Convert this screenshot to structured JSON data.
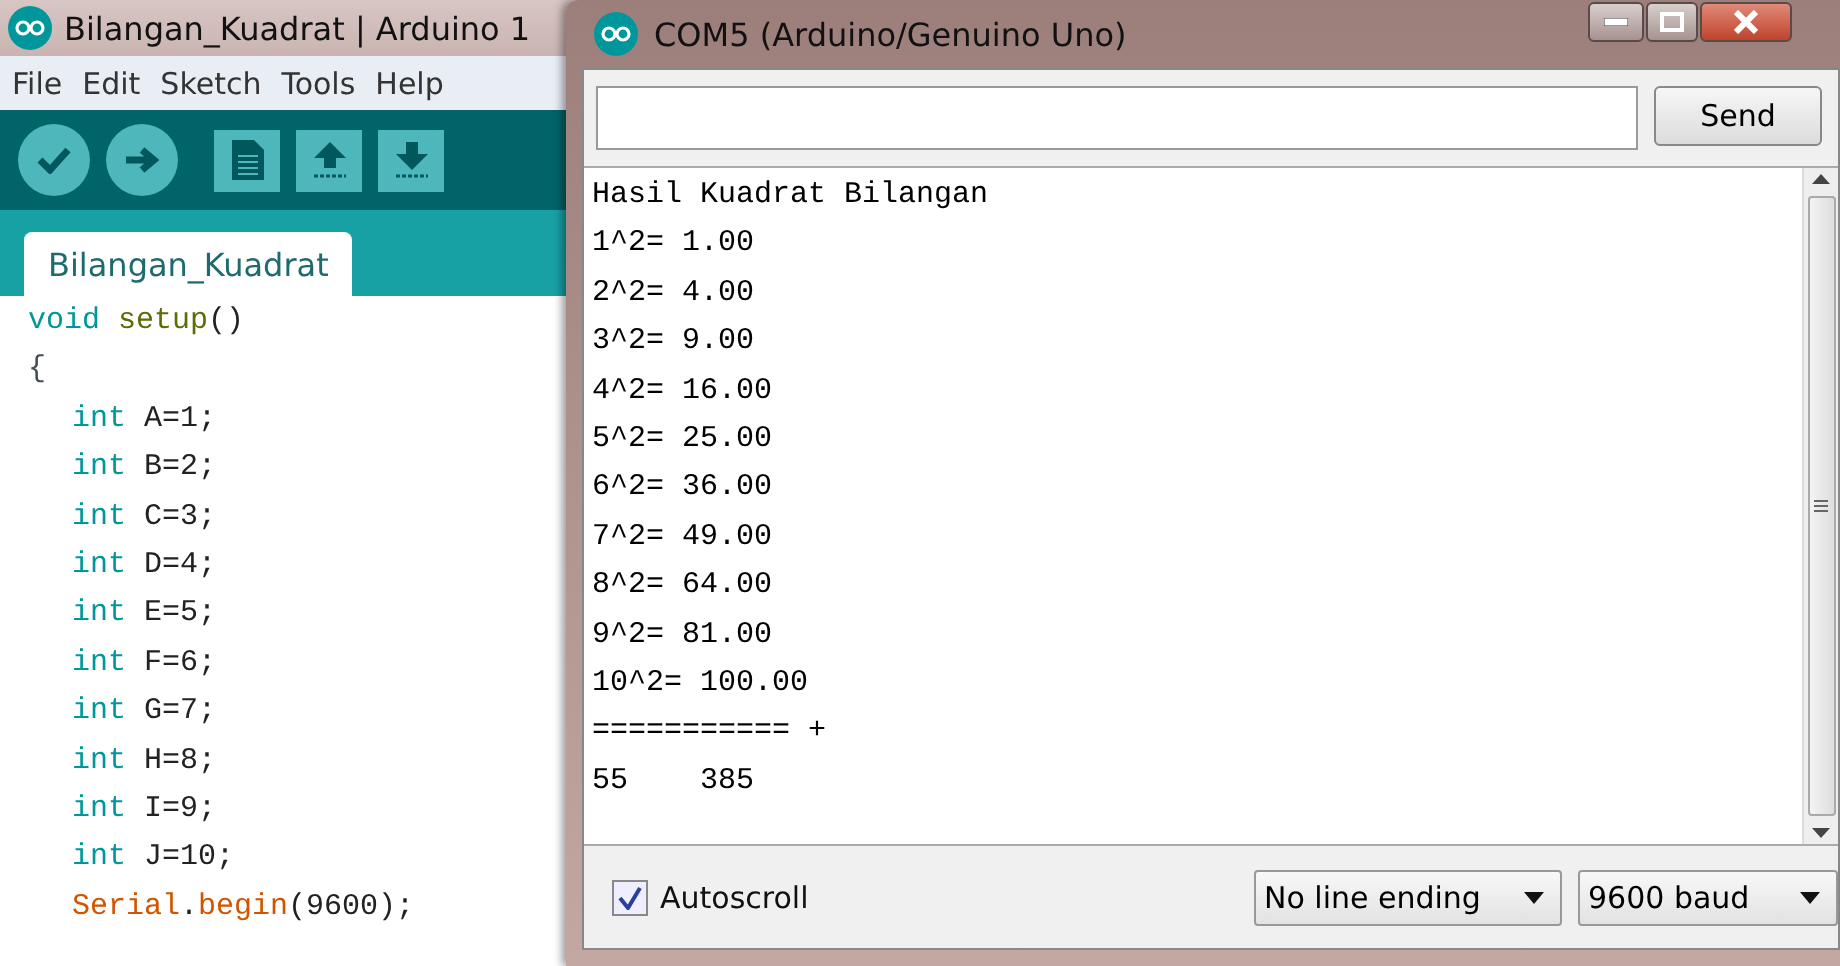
{
  "ide": {
    "title": "Bilangan_Kuadrat | Arduino 1",
    "menu": [
      "File",
      "Edit",
      "Sketch",
      "Tools",
      "Help"
    ],
    "toolbar": [
      {
        "kind": "verify"
      },
      {
        "kind": "upload"
      },
      {
        "kind": "new"
      },
      {
        "kind": "open"
      },
      {
        "kind": "save"
      }
    ],
    "tabs": [
      {
        "label": "Bilangan_Kuadrat",
        "selected": true
      }
    ],
    "code": [
      {
        "indented": false,
        "tokens": [
          {
            "text": "void",
            "kind": "keyword"
          },
          {
            "text": " setup",
            "kind": "function"
          },
          {
            "text": "()",
            "kind": "plain"
          }
        ]
      },
      {
        "indented": false,
        "tokens": [
          {
            "text": "{",
            "kind": "brace"
          }
        ]
      },
      {
        "indented": true,
        "tokens": [
          {
            "text": "int",
            "kind": "keyword"
          },
          {
            "text": " A=1;",
            "kind": "plain"
          }
        ]
      },
      {
        "indented": true,
        "tokens": [
          {
            "text": "int",
            "kind": "keyword"
          },
          {
            "text": " B=2;",
            "kind": "plain"
          }
        ]
      },
      {
        "indented": true,
        "tokens": [
          {
            "text": "int",
            "kind": "keyword"
          },
          {
            "text": " C=3;",
            "kind": "plain"
          }
        ]
      },
      {
        "indented": true,
        "tokens": [
          {
            "text": "int",
            "kind": "keyword"
          },
          {
            "text": " D=4;",
            "kind": "plain"
          }
        ]
      },
      {
        "indented": true,
        "tokens": [
          {
            "text": "int",
            "kind": "keyword"
          },
          {
            "text": " E=5;",
            "kind": "plain"
          }
        ]
      },
      {
        "indented": true,
        "tokens": [
          {
            "text": "int",
            "kind": "keyword"
          },
          {
            "text": " F=6;",
            "kind": "plain"
          }
        ]
      },
      {
        "indented": true,
        "tokens": [
          {
            "text": "int",
            "kind": "keyword"
          },
          {
            "text": " G=7;",
            "kind": "plain"
          }
        ]
      },
      {
        "indented": true,
        "tokens": [
          {
            "text": "int",
            "kind": "keyword"
          },
          {
            "text": " H=8;",
            "kind": "plain"
          }
        ]
      },
      {
        "indented": true,
        "tokens": [
          {
            "text": "int",
            "kind": "keyword"
          },
          {
            "text": " I=9;",
            "kind": "plain"
          }
        ]
      },
      {
        "indented": true,
        "tokens": [
          {
            "text": "int",
            "kind": "keyword"
          },
          {
            "text": " J=10;",
            "kind": "plain"
          }
        ]
      },
      {
        "indented": true,
        "tokens": [
          {
            "text": "Serial",
            "kind": "class"
          },
          {
            "text": ".",
            "kind": "plain"
          },
          {
            "text": "begin",
            "kind": "class"
          },
          {
            "text": "(9600);",
            "kind": "plain"
          }
        ]
      }
    ]
  },
  "serial_monitor": {
    "title": "COM5 (Arduino/Genuino Uno)",
    "send_button": "Send",
    "output": [
      "Hasil Kuadrat Bilangan",
      "1^2= 1.00",
      "2^2= 4.00",
      "3^2= 9.00",
      "4^2= 16.00",
      "5^2= 25.00",
      "6^2= 36.00",
      "7^2= 49.00",
      "8^2= 64.00",
      "9^2= 81.00",
      "10^2= 100.00",
      "=========== +",
      "55    385"
    ],
    "autoscroll": {
      "label": "Autoscroll",
      "checked": true
    },
    "line_ending": "No line ending",
    "baud": "9600 baud"
  }
}
